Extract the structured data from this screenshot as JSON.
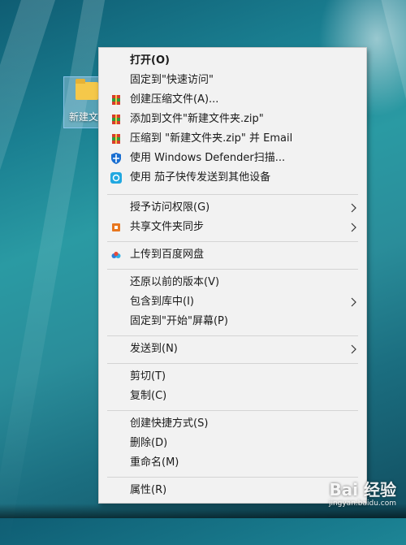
{
  "desktop": {
    "folder_label": "新建文",
    "watermark_logo": "Bai 经验",
    "watermark_site": "jingyan.baidu.com"
  },
  "menu": {
    "items": [
      {
        "label": "打开(O)",
        "icon": "",
        "submenu": false
      },
      {
        "label": "固定到\"快速访问\"",
        "icon": "",
        "submenu": false
      },
      {
        "label": "创建压缩文件(A)...",
        "icon": "archive-icon",
        "submenu": false
      },
      {
        "label": "添加到文件\"新建文件夹.zip\"",
        "icon": "archive-icon",
        "submenu": false
      },
      {
        "label": "压缩到 \"新建文件夹.zip\" 并 Email",
        "icon": "archive-icon",
        "submenu": false
      },
      {
        "label": "使用 Windows Defender扫描...",
        "icon": "defender-shield-icon",
        "submenu": false
      },
      {
        "label": "使用 茄子快传发送到其他设备",
        "icon": "send-app-icon",
        "submenu": false
      },
      {
        "label": "授予访问权限(G)",
        "icon": "",
        "submenu": true
      },
      {
        "label": "共享文件夹同步",
        "icon": "sync-icon",
        "submenu": true
      },
      {
        "label": "上传到百度网盘",
        "icon": "cloud-icon",
        "submenu": false
      },
      {
        "label": "还原以前的版本(V)",
        "icon": "",
        "submenu": false
      },
      {
        "label": "包含到库中(I)",
        "icon": "",
        "submenu": true
      },
      {
        "label": "固定到\"开始\"屏幕(P)",
        "icon": "",
        "submenu": false
      },
      {
        "label": "发送到(N)",
        "icon": "",
        "submenu": true
      },
      {
        "label": "剪切(T)",
        "icon": "",
        "submenu": false
      },
      {
        "label": "复制(C)",
        "icon": "",
        "submenu": false
      },
      {
        "label": "创建快捷方式(S)",
        "icon": "",
        "submenu": false
      },
      {
        "label": "删除(D)",
        "icon": "",
        "submenu": false
      },
      {
        "label": "重命名(M)",
        "icon": "",
        "submenu": false
      },
      {
        "label": "属性(R)",
        "icon": "",
        "submenu": false
      }
    ]
  },
  "colors": {
    "menu_bg": "#f2f2f2",
    "separator": "#d4d4d4",
    "defender_blue": "#1a6fd1",
    "archive_red": "#d83b2d",
    "archive_green": "#2e9e3d",
    "send_app_teal": "#21a8e0",
    "sync_orange": "#e8771f"
  }
}
